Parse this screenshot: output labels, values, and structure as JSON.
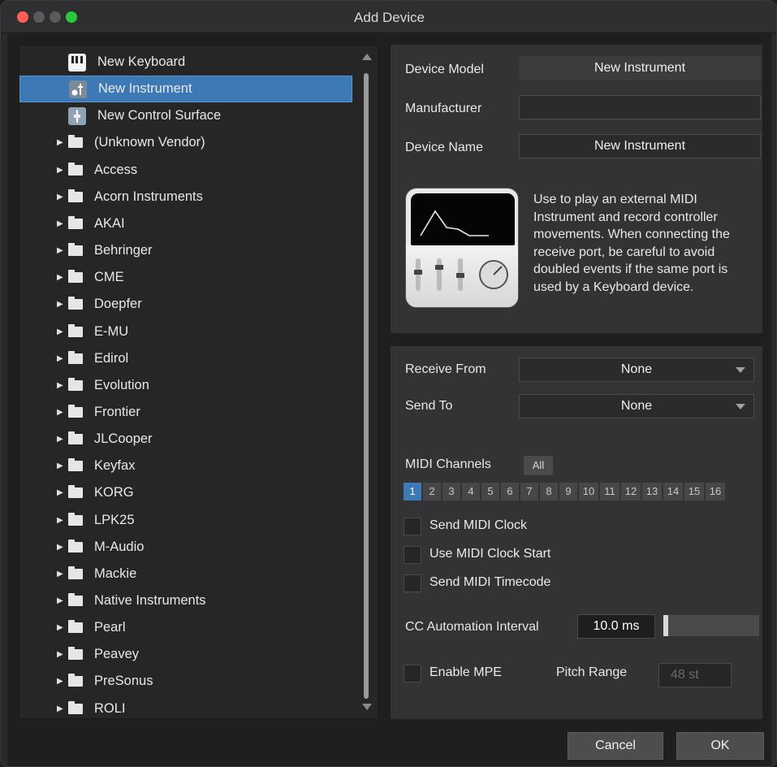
{
  "window": {
    "title": "Add Device"
  },
  "tree": {
    "items": [
      {
        "label": "New Keyboard",
        "kind": "keyboard"
      },
      {
        "label": "New Instrument",
        "kind": "instrument",
        "selected": true
      },
      {
        "label": "New Control Surface",
        "kind": "control"
      },
      {
        "label": "(Unknown Vendor)",
        "kind": "folder"
      },
      {
        "label": "Access",
        "kind": "folder"
      },
      {
        "label": "Acorn Instruments",
        "kind": "folder"
      },
      {
        "label": "AKAI",
        "kind": "folder"
      },
      {
        "label": "Behringer",
        "kind": "folder"
      },
      {
        "label": "CME",
        "kind": "folder"
      },
      {
        "label": "Doepfer",
        "kind": "folder"
      },
      {
        "label": "E-MU",
        "kind": "folder"
      },
      {
        "label": "Edirol",
        "kind": "folder"
      },
      {
        "label": "Evolution",
        "kind": "folder"
      },
      {
        "label": "Frontier",
        "kind": "folder"
      },
      {
        "label": "JLCooper",
        "kind": "folder"
      },
      {
        "label": "Keyfax",
        "kind": "folder"
      },
      {
        "label": "KORG",
        "kind": "folder"
      },
      {
        "label": "LPK25",
        "kind": "folder"
      },
      {
        "label": "M-Audio",
        "kind": "folder"
      },
      {
        "label": "Mackie",
        "kind": "folder"
      },
      {
        "label": "Native Instruments",
        "kind": "folder"
      },
      {
        "label": "Pearl",
        "kind": "folder"
      },
      {
        "label": "Peavey",
        "kind": "folder"
      },
      {
        "label": "PreSonus",
        "kind": "folder"
      },
      {
        "label": "ROLI",
        "kind": "folder"
      }
    ]
  },
  "info": {
    "device_model_label": "Device Model",
    "device_model_value": "New Instrument",
    "manufacturer_label": "Manufacturer",
    "manufacturer_value": "",
    "device_name_label": "Device Name",
    "device_name_value": "New Instrument",
    "description": "Use to play an external MIDI Instrument and record controller movements. When connecting the receive port, be careful to avoid doubled events if the same port is used by a Keyboard device."
  },
  "io": {
    "receive_from_label": "Receive From",
    "receive_from_value": "None",
    "send_to_label": "Send To",
    "send_to_value": "None",
    "midi_channels_label": "MIDI Channels",
    "all_label": "All",
    "channels": [
      "1",
      "2",
      "3",
      "4",
      "5",
      "6",
      "7",
      "8",
      "9",
      "10",
      "11",
      "12",
      "13",
      "14",
      "15",
      "16"
    ],
    "active_channel": "1",
    "send_midi_clock": "Send MIDI Clock",
    "use_midi_clock_start": "Use MIDI Clock Start",
    "send_midi_timecode": "Send MIDI Timecode",
    "cc_interval_label": "CC Automation Interval",
    "cc_interval_value": "10.0 ms",
    "cc_interval_level": 0.05,
    "enable_mpe": "Enable MPE",
    "pitch_range_label": "Pitch Range",
    "pitch_range_value": "48 st"
  },
  "buttons": {
    "cancel": "Cancel",
    "ok": "OK"
  }
}
